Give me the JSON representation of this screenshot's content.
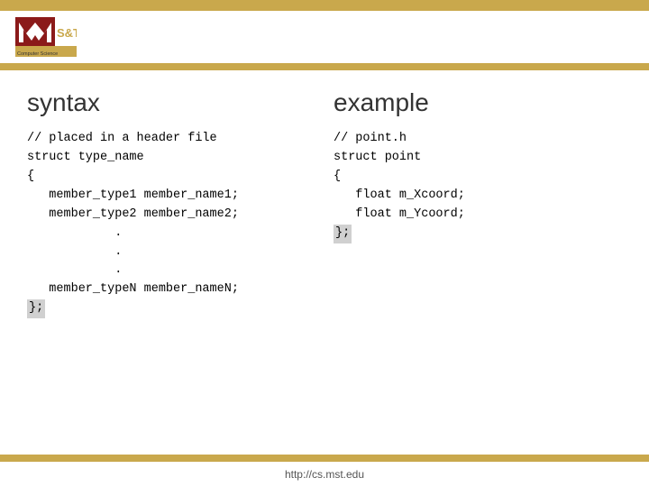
{
  "header": {
    "logo_alt": "Missouri S&T Computer Science logo"
  },
  "top_bar": {
    "color": "#c9a84c"
  },
  "syntax_section": {
    "title": "syntax",
    "lines": [
      "// placed in a header file",
      "struct type_name",
      "{",
      "   member_type1 member_name1;",
      "   member_type2 member_name2;",
      "            .",
      "            .",
      "            .",
      "   member_typeN member_nameN;",
      "};"
    ]
  },
  "example_section": {
    "title": "example",
    "lines": [
      "// point.h",
      "struct point",
      "{",
      "   float m_Xcoord;",
      "   float m_Ycoord;",
      "};"
    ],
    "highlighted_line": "};"
  },
  "footer": {
    "url": "http://cs.mst.edu"
  }
}
